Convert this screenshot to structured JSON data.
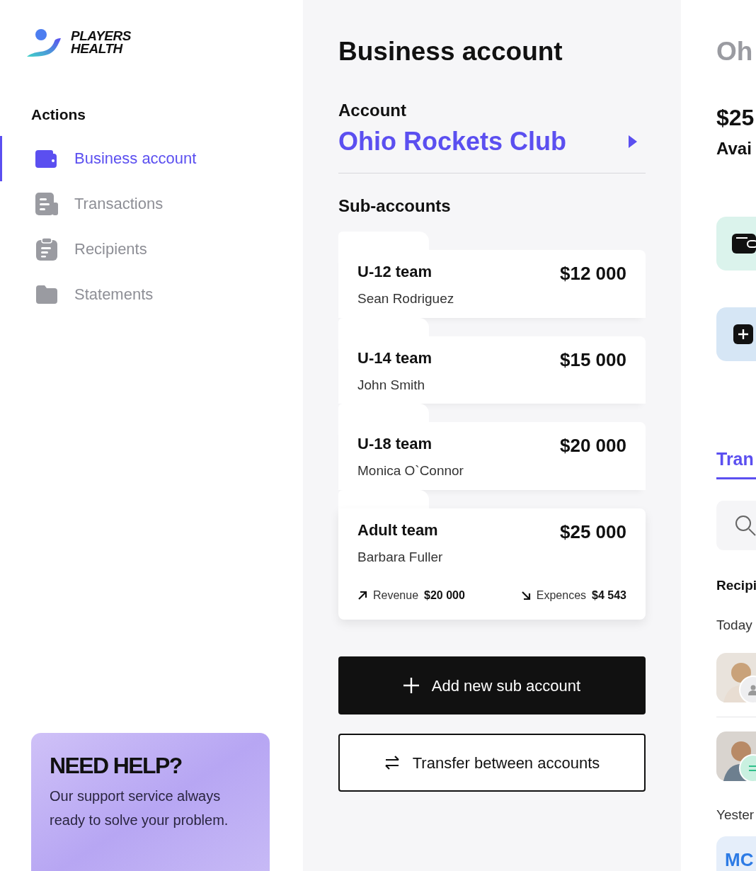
{
  "sidebar": {
    "logo": {
      "line_1": "PLAYERS",
      "line_2": "HEALTH"
    },
    "section_title": "Actions",
    "items": [
      {
        "label": "Business account",
        "selected": true
      },
      {
        "label": "Transactions",
        "selected": false
      },
      {
        "label": "Recipients",
        "selected": false
      },
      {
        "label": "Statements",
        "selected": false
      }
    ],
    "help_card": {
      "title": "NEED HELP?",
      "text": "Our support service always ready to solve your problem."
    }
  },
  "main": {
    "title": "Business account",
    "account_label": "Account",
    "account_name": "Ohio Rockets Club",
    "sub_accounts_title": "Sub-accounts",
    "sub_accounts": [
      {
        "name": "U-12 team",
        "owner": "Sean Rodriguez",
        "amount": "$12 000"
      },
      {
        "name": "U-14 team",
        "owner": "John Smith",
        "amount": "$15 000"
      },
      {
        "name": "U-18 team",
        "owner": "Monica O`Connor",
        "amount": "$20 000"
      },
      {
        "name": "Adult team",
        "owner": "Barbara Fuller",
        "amount": "$25 000",
        "revenue_label": "Revenue",
        "revenue": "$20 000",
        "expenses_label": "Expences",
        "expenses": "$4 543"
      }
    ],
    "buttons": [
      {
        "label": "Add new sub account",
        "kind": "primary"
      },
      {
        "label": "Transfer between accounts",
        "kind": "secondary"
      }
    ]
  },
  "right_panel": {
    "title": "Oh",
    "balance": "$25",
    "balance_label": "Avai",
    "tab": {
      "label": "Tran",
      "selected": true
    },
    "section_title": "Recipi",
    "groups": [
      {
        "label": "Today",
        "avatars": [
          {
            "kind": "person"
          },
          {
            "kind": "transfer"
          }
        ]
      },
      {
        "label": "Yester",
        "card_text": "MC"
      }
    ]
  }
}
